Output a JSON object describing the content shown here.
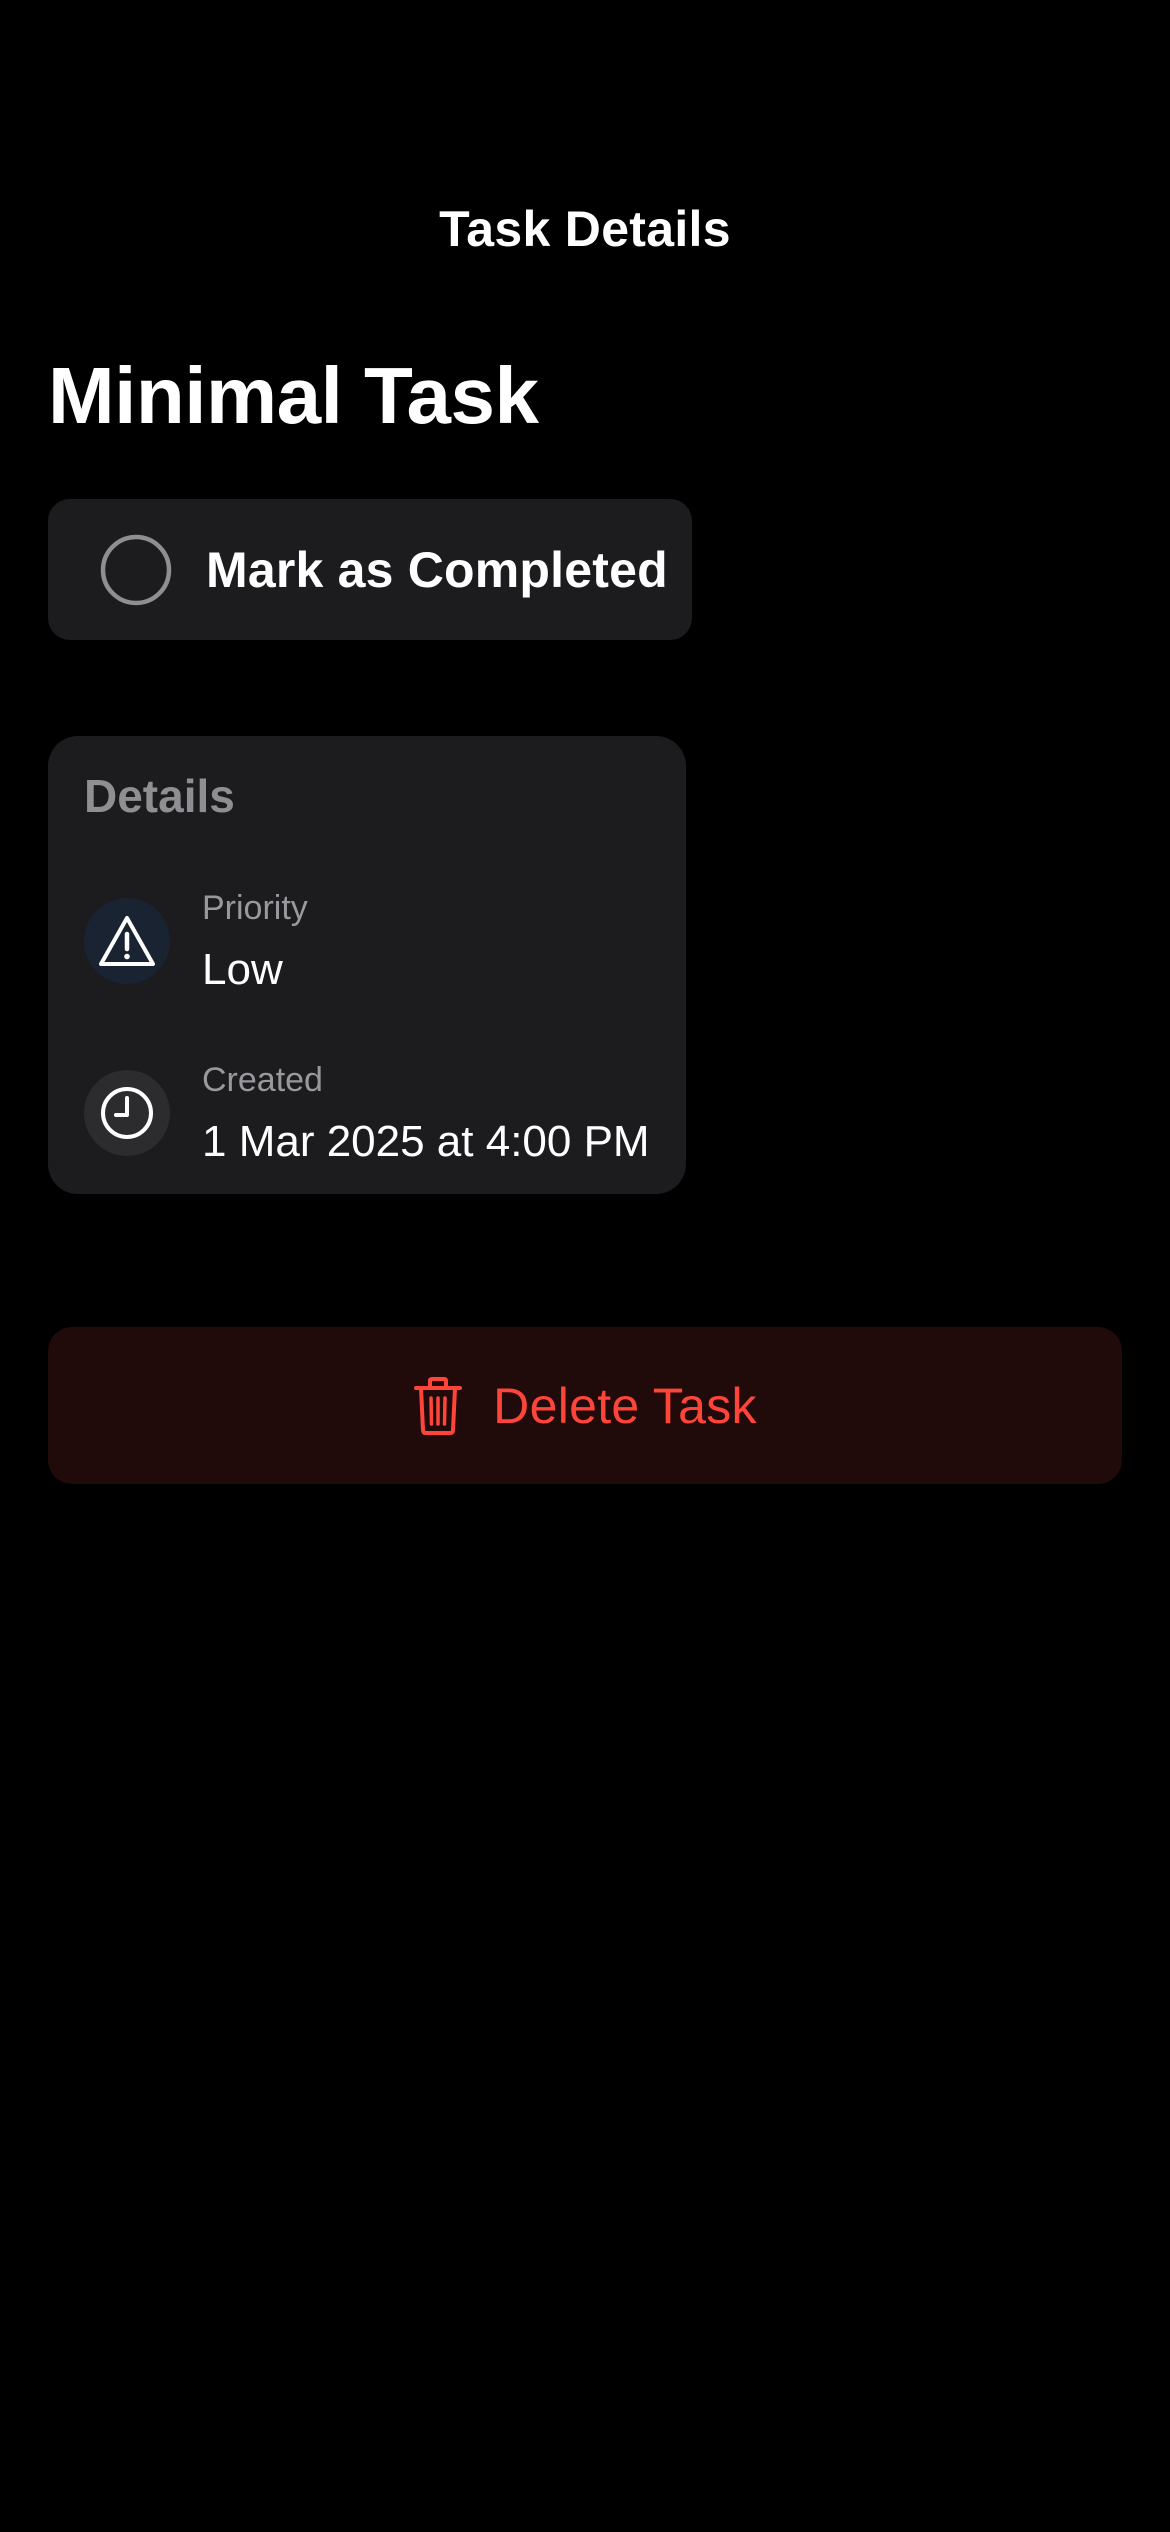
{
  "nav": {
    "title": "Task Details"
  },
  "task": {
    "title": "Minimal Task"
  },
  "complete_button": {
    "label": "Mark as Completed",
    "icon": "circle-icon",
    "checked": false
  },
  "details": {
    "heading": "Details",
    "rows": [
      {
        "label": "Priority",
        "value": "Low",
        "icon": "warning-triangle-icon"
      },
      {
        "label": "Created",
        "value": "1 Mar 2025 at 4:00 PM",
        "icon": "clock-icon"
      }
    ]
  },
  "delete_button": {
    "label": "Delete Task",
    "icon": "trash-icon"
  },
  "colors": {
    "background": "#000000",
    "card": "#1c1c1e",
    "destructive": "#ff453a",
    "destructive_bg": "#200a0a",
    "secondary_text": "#8e8e93"
  }
}
